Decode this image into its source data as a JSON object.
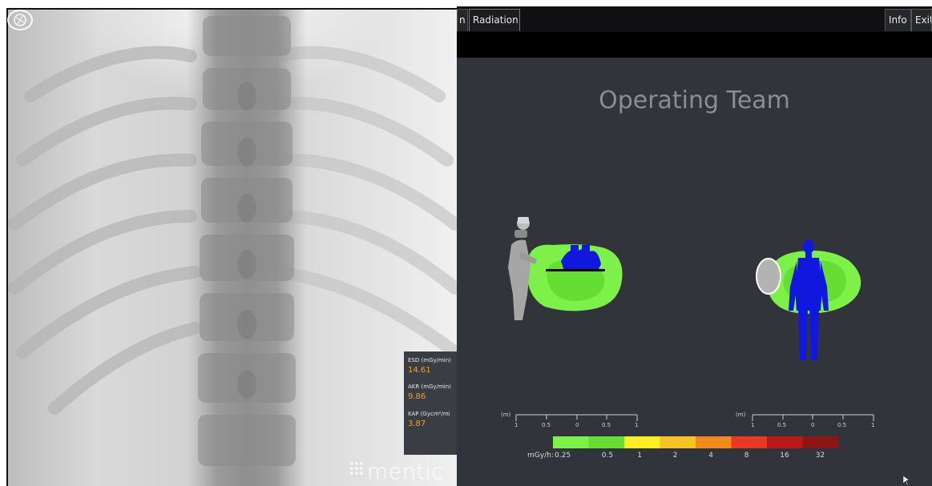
{
  "fluoroscopy": {
    "readouts": [
      {
        "label": "ESD (mGy/min)",
        "value": "14.61"
      },
      {
        "label": "AKR (mGy/min)",
        "value": "9.86"
      },
      {
        "label": "KAP (Gycm²/mi",
        "value": "3.87"
      }
    ],
    "brand": "mentic",
    "icons": {
      "camera": "camera-aperture-icon",
      "brand_mark": "dot-grid-icon"
    }
  },
  "radiation": {
    "tabs": {
      "left_partial": "n",
      "active": "Radiation",
      "info": "Info",
      "exit": "Exit"
    },
    "title": "Operating Team",
    "scale": {
      "unit": "(m)",
      "ticks": [
        "1",
        "0.5",
        "0",
        "0.5",
        "1"
      ]
    },
    "legend": {
      "unit": "mGy/h:",
      "values": [
        "0.25",
        "0.5",
        "1",
        "2",
        "4",
        "8",
        "16",
        "32"
      ],
      "colors": [
        "#7ef04a",
        "#66dd33",
        "#ffee22",
        "#f5c422",
        "#f08a1e",
        "#e83a22",
        "#b81a1a",
        "#8a1616"
      ]
    },
    "colors": {
      "background": "#32343b",
      "dose_low": "#7ef04a",
      "dose_mid": "#66dd33",
      "body": "#1018dd"
    }
  }
}
